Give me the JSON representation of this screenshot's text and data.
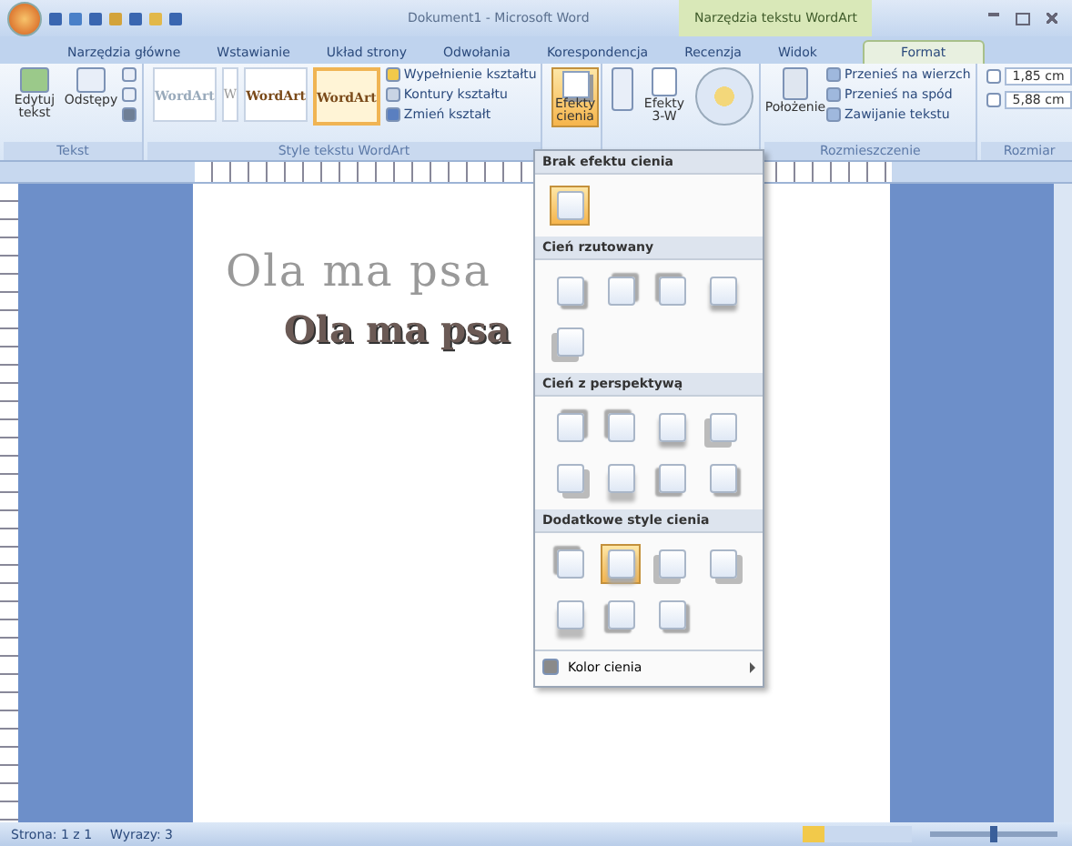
{
  "window": {
    "title": "Dokument1 - Microsoft Word",
    "context_title": "Narzędzia tekstu WordArt"
  },
  "tabs": [
    {
      "label": "Narzędzia główne",
      "selected": false
    },
    {
      "label": "Wstawianie",
      "selected": false
    },
    {
      "label": "Układ strony",
      "selected": false
    },
    {
      "label": "Odwołania",
      "selected": false
    },
    {
      "label": "Korespondencja",
      "selected": false
    },
    {
      "label": "Recenzja",
      "selected": false
    },
    {
      "label": "Widok",
      "selected": false
    },
    {
      "label": "Format",
      "selected": true
    }
  ],
  "ribbon": {
    "text_group": {
      "label": "Tekst",
      "buttons": [
        "Edytuj tekst",
        "Odstępy"
      ]
    },
    "styles_group": {
      "label": "Style tekstu WordArt",
      "samples": [
        {
          "text": "WordArt",
          "selected": false
        },
        {
          "text": "W",
          "selected": false
        },
        {
          "text": "WordArt",
          "selected": false
        },
        {
          "text": "WordArt",
          "selected": true
        }
      ],
      "commands": [
        "Wypełnienie kształtu",
        "Kontury kształtu",
        "Zmień kształt"
      ]
    },
    "shadow_button": {
      "label": "Efekty cienia",
      "expanded": true
    },
    "effects_3d": {
      "label": "Efekty 3-W"
    },
    "arrange_group": {
      "label": "Rozmieszczenie",
      "position": "Położenie",
      "commands": [
        "Przenieś na wierzch",
        "Przenieś na spód",
        "Zawijanie tekstu"
      ]
    },
    "size_group": {
      "label": "Rozmiar",
      "height": "1,85 cm",
      "width": "5,88 cm"
    }
  },
  "document": {
    "wordart_outline": "Ola ma psa",
    "wordart_text": "Ola ma psa"
  },
  "shadow_menu": {
    "sections": [
      {
        "title": "Brak efektu cienia",
        "items": [
          {
            "selected": true
          }
        ]
      },
      {
        "title": "Cień rzutowany",
        "items": [
          {
            "selected": false
          },
          {
            "selected": false
          },
          {
            "selected": false
          },
          {
            "selected": false
          },
          {
            "selected": false
          }
        ]
      },
      {
        "title": "Cień z perspektywą",
        "items": [
          {
            "selected": false
          },
          {
            "selected": false
          },
          {
            "selected": false
          },
          {
            "selected": false
          },
          {
            "selected": false
          },
          {
            "selected": false
          },
          {
            "selected": false
          },
          {
            "selected": false
          }
        ]
      },
      {
        "title": "Dodatkowe style cienia",
        "items": [
          {
            "selected": false
          },
          {
            "selected": true
          },
          {
            "selected": false
          },
          {
            "selected": false
          },
          {
            "selected": false
          },
          {
            "selected": false
          },
          {
            "selected": false
          }
        ]
      }
    ],
    "footer": "Kolor cienia"
  },
  "status_bar": {
    "page": "Strona: 1 z 1",
    "words": "Wyrazy: 3",
    "zoom": {
      "level": 0.5
    }
  }
}
